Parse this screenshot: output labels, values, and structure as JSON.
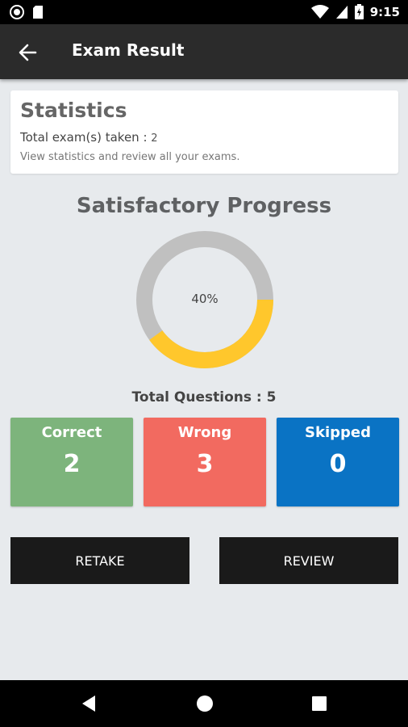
{
  "status_bar": {
    "time": "9:15",
    "icons": [
      "record-icon",
      "sd-card-icon",
      "wifi-icon",
      "signal-icon",
      "battery-icon"
    ]
  },
  "app_bar": {
    "title": "Exam Result",
    "back_icon": "arrow-left-icon"
  },
  "statistics": {
    "title": "Statistics",
    "total_label": "Total exam(s) taken :",
    "total_value": "2",
    "subtitle": "View statistics and review all your exams."
  },
  "progress": {
    "title": "Satisfactory Progress",
    "percent_label": "40%",
    "percent": 40,
    "ring_color": "#ffc72c",
    "track_color": "#c0c0c0"
  },
  "summary": {
    "total_questions": "Total Questions : 5"
  },
  "tiles": {
    "correct": {
      "label": "Correct",
      "value": "2",
      "color": "#7db47c"
    },
    "wrong": {
      "label": "Wrong",
      "value": "3",
      "color": "#f26a60"
    },
    "skipped": {
      "label": "Skipped",
      "value": "0",
      "color": "#0a73c4"
    }
  },
  "actions": {
    "retake": "RETAKE",
    "review": "REVIEW"
  },
  "nav_bar": {
    "icons": [
      "nav-back-icon",
      "nav-home-icon",
      "nav-recents-icon"
    ]
  }
}
